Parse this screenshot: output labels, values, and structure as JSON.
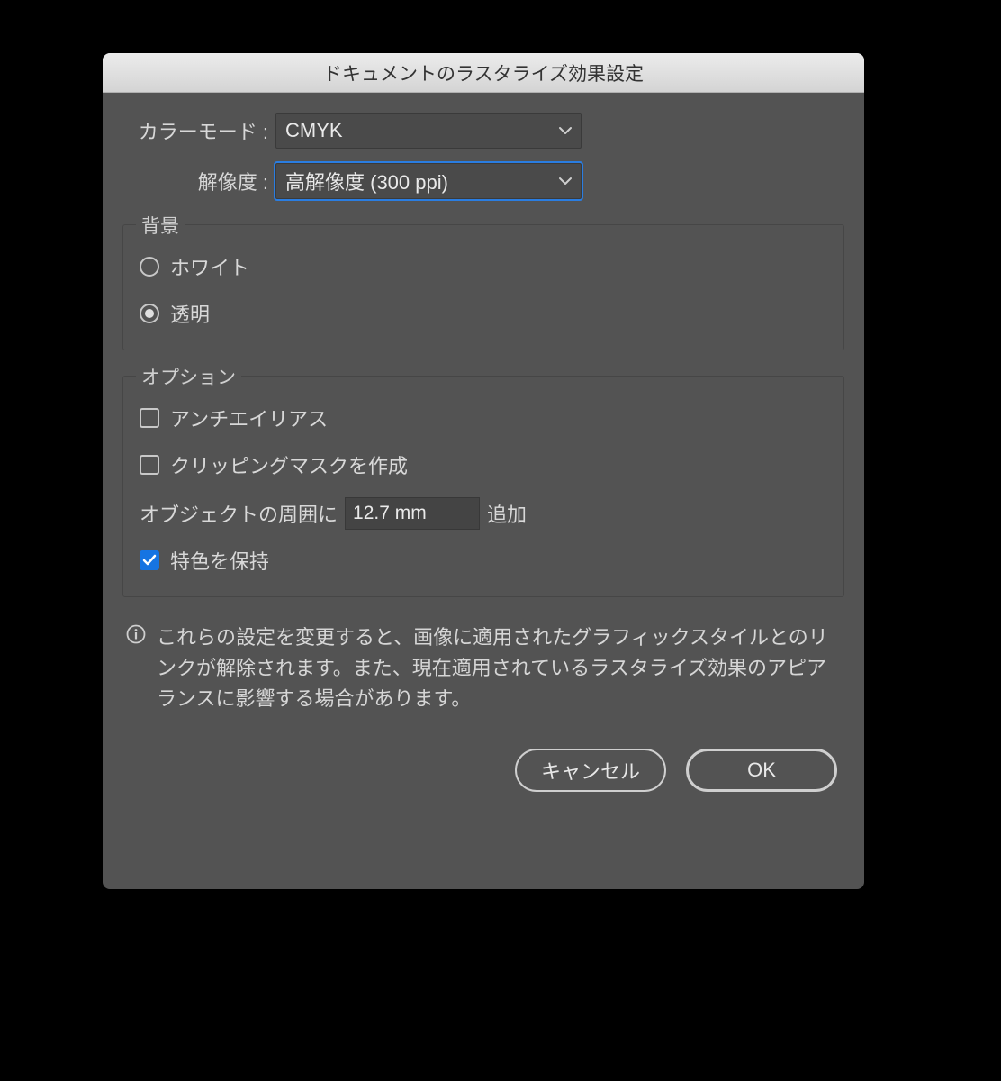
{
  "title": "ドキュメントのラスタライズ効果設定",
  "form": {
    "color_mode_label": "カラーモード :",
    "color_mode_value": "CMYK",
    "resolution_label": "解像度 :",
    "resolution_value": "高解像度 (300 ppi)"
  },
  "background": {
    "legend": "背景",
    "white": "ホワイト",
    "transparent": "透明",
    "selected": "transparent"
  },
  "options": {
    "legend": "オプション",
    "antialias": "アンチエイリアス",
    "clipping_mask": "クリッピングマスクを作成",
    "add_around_prefix": "オブジェクトの周囲に",
    "add_around_value": "12.7 mm",
    "add_around_suffix": "追加",
    "preserve_spot": "特色を保持",
    "antialias_checked": false,
    "clipping_mask_checked": false,
    "preserve_spot_checked": true
  },
  "info_text": "これらの設定を変更すると、画像に適用されたグラフィックスタイルとのリンクが解除されます。また、現在適用されているラスタライズ効果のアピアランスに影響する場合があります。",
  "buttons": {
    "cancel": "キャンセル",
    "ok": "OK"
  }
}
